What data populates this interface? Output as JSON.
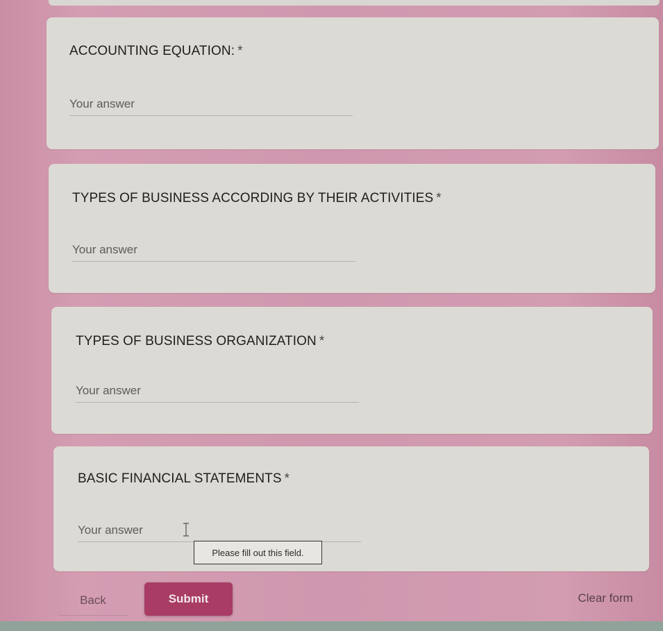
{
  "questions": [
    {
      "title": "ACCOUNTING EQUATION:",
      "required_mark": "*",
      "placeholder": "Your answer"
    },
    {
      "title": "TYPES OF BUSINESS ACCORDING BY THEIR ACTIVITIES",
      "required_mark": "*",
      "placeholder": "Your answer"
    },
    {
      "title": "TYPES OF BUSINESS ORGANIZATION",
      "required_mark": "*",
      "placeholder": "Your answer"
    },
    {
      "title": "BASIC FINANCIAL STATEMENTS",
      "required_mark": "*",
      "placeholder": "Your answer"
    }
  ],
  "validation": {
    "message": "Please fill out this field."
  },
  "actions": {
    "back": "Back",
    "submit": "Submit",
    "clear": "Clear form"
  },
  "colors": {
    "submit_bg": "#a83c64",
    "card_bg": "#dcdad4",
    "page_bg": "#cf98ae"
  }
}
